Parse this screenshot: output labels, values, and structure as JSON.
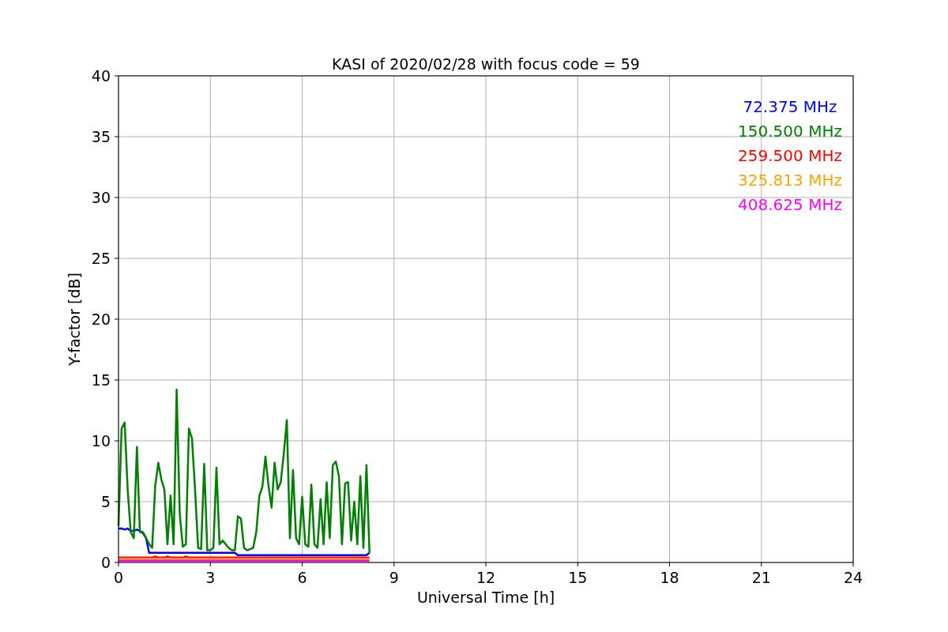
{
  "chart_data": {
    "type": "line",
    "title": "KASI of 2020/02/28 with focus code = 59",
    "xlabel": "Universal Time [h]",
    "ylabel": "Y-factor [dB]",
    "x": [
      0,
      0.1,
      0.2,
      0.3,
      0.4,
      0.5,
      0.6,
      0.7,
      0.8,
      0.9,
      1,
      1.1,
      1.2,
      1.3,
      1.4,
      1.5,
      1.6,
      1.7,
      1.8,
      1.9,
      2,
      2.1,
      2.2,
      2.3,
      2.4,
      2.5,
      2.6,
      2.7,
      2.8,
      2.9,
      3,
      3.1,
      3.2,
      3.3,
      3.4,
      3.5,
      3.6,
      3.7,
      3.8,
      3.9,
      4,
      4.1,
      4.2,
      4.3,
      4.4,
      4.5,
      4.6,
      4.7,
      4.8,
      4.9,
      5,
      5.1,
      5.2,
      5.3,
      5.4,
      5.5,
      5.6,
      5.7,
      5.8,
      5.9,
      6,
      6.1,
      6.2,
      6.3,
      6.4,
      6.5,
      6.6,
      6.7,
      6.8,
      6.9,
      7,
      7.1,
      7.2,
      7.3,
      7.4,
      7.5,
      7.6,
      7.7,
      7.8,
      7.9,
      8,
      8.1,
      8.2
    ],
    "series": [
      {
        "name": "72.375 MHz",
        "color": "#0000ff",
        "values": [
          2.8,
          2.8,
          2.7,
          2.8,
          2.6,
          2.6,
          2.7,
          2.6,
          2.4,
          2.0,
          0.8,
          0.8,
          0.8,
          0.8,
          0.8,
          0.8,
          0.8,
          0.8,
          0.8,
          0.8,
          0.8,
          0.8,
          0.8,
          0.8,
          0.8,
          0.8,
          0.8,
          0.8,
          0.8,
          0.8,
          0.8,
          0.8,
          0.8,
          0.8,
          0.8,
          0.8,
          0.8,
          0.8,
          0.8,
          0.6,
          0.6,
          0.6,
          0.6,
          0.6,
          0.6,
          0.6,
          0.6,
          0.6,
          0.6,
          0.6,
          0.6,
          0.6,
          0.6,
          0.6,
          0.6,
          0.6,
          0.6,
          0.6,
          0.6,
          0.6,
          0.6,
          0.6,
          0.6,
          0.6,
          0.6,
          0.6,
          0.6,
          0.6,
          0.6,
          0.6,
          0.6,
          0.6,
          0.6,
          0.6,
          0.6,
          0.6,
          0.6,
          0.6,
          0.6,
          0.6,
          0.6,
          0.6,
          0.8
        ]
      },
      {
        "name": "150.500 MHz",
        "color": "#008000",
        "values": [
          3,
          11,
          11.5,
          6,
          2.5,
          2,
          9.5,
          2.5,
          2.5,
          2,
          1.5,
          1.2,
          6.3,
          8.2,
          6.8,
          6,
          1.5,
          5.5,
          1.5,
          14.2,
          4,
          1.3,
          1.5,
          11,
          10.2,
          6,
          1.2,
          1.1,
          8.1,
          1,
          1,
          1.2,
          7.8,
          1.5,
          1.8,
          1.5,
          1.2,
          1,
          1,
          3.8,
          3.6,
          1.2,
          1,
          1.1,
          1.2,
          2.5,
          5.5,
          6.2,
          8.7,
          6.3,
          4.5,
          8.2,
          6,
          6.6,
          9,
          11.7,
          2,
          7.6,
          2,
          1.5,
          5.4,
          1.5,
          1.3,
          6.4,
          1.5,
          1.2,
          5.2,
          1.5,
          6.6,
          2,
          8,
          8.3,
          7.1,
          1.5,
          6.5,
          6.6,
          1.8,
          5,
          1.5,
          7.1,
          1.2,
          8,
          0.8
        ]
      },
      {
        "name": "259.500 MHz",
        "color": "#ff0000",
        "values": [
          0.4,
          0.4,
          0.4,
          0.4,
          0.4,
          0.4,
          0.4,
          0.4,
          0.4,
          0.4,
          0.4,
          0.4,
          0.5,
          0.4,
          0.4,
          0.4,
          0.5,
          0.4,
          0.4,
          0.4,
          0.4,
          0.4,
          0.5,
          0.4,
          0.4,
          0.4,
          0.4,
          0.4,
          0.4,
          0.4,
          0.4,
          0.4,
          0.4,
          0.4,
          0.4,
          0.4,
          0.4,
          0.4,
          0.4,
          0.4,
          0.4,
          0.4,
          0.4,
          0.4,
          0.4,
          0.4,
          0.4,
          0.4,
          0.4,
          0.4,
          0.4,
          0.4,
          0.4,
          0.4,
          0.4,
          0.4,
          0.4,
          0.4,
          0.4,
          0.4,
          0.4,
          0.4,
          0.4,
          0.4,
          0.4,
          0.4,
          0.4,
          0.4,
          0.4,
          0.4,
          0.4,
          0.4,
          0.4,
          0.4,
          0.4,
          0.4,
          0.4,
          0.4,
          0.4,
          0.4,
          0.4,
          0.4,
          0.4
        ]
      },
      {
        "name": "325.813 MHz",
        "color": "#ffa500",
        "values": [
          0.3,
          0.3,
          0.3,
          0.3,
          0.3,
          0.3,
          0.3,
          0.3,
          0.3,
          0.3,
          0.3,
          0.3,
          0.3,
          0.3,
          0.3,
          0.3,
          0.3,
          0.3,
          0.3,
          0.3,
          0.3,
          0.3,
          0.3,
          0.3,
          0.3,
          0.3,
          0.3,
          0.3,
          0.3,
          0.3,
          0.3,
          0.3,
          0.3,
          0.3,
          0.3,
          0.3,
          0.3,
          0.3,
          0.3,
          0.3,
          0.3,
          0.3,
          0.3,
          0.3,
          0.3,
          0.3,
          0.3,
          0.3,
          0.3,
          0.3,
          0.3,
          0.3,
          0.3,
          0.3,
          0.3,
          0.3,
          0.3,
          0.3,
          0.3,
          0.3,
          0.3,
          0.3,
          0.3,
          0.3,
          0.3,
          0.3,
          0.3,
          0.3,
          0.3,
          0.3,
          0.3,
          0.3,
          0.3,
          0.3,
          0.3,
          0.3,
          0.3,
          0.3,
          0.3,
          0.3,
          0.3,
          0.3,
          0.3
        ]
      },
      {
        "name": "408.625 MHz",
        "color": "#ff00ff",
        "values": [
          0.15,
          0.15,
          0.15,
          0.15,
          0.15,
          0.15,
          0.15,
          0.15,
          0.15,
          0.15,
          0.15,
          0.15,
          0.15,
          0.15,
          0.15,
          0.15,
          0.15,
          0.15,
          0.15,
          0.15,
          0.15,
          0.15,
          0.15,
          0.15,
          0.15,
          0.15,
          0.15,
          0.15,
          0.15,
          0.15,
          0.15,
          0.15,
          0.15,
          0.15,
          0.15,
          0.15,
          0.15,
          0.15,
          0.15,
          0.15,
          0.15,
          0.15,
          0.15,
          0.15,
          0.15,
          0.15,
          0.15,
          0.15,
          0.15,
          0.15,
          0.15,
          0.15,
          0.15,
          0.15,
          0.15,
          0.15,
          0.15,
          0.15,
          0.15,
          0.15,
          0.15,
          0.15,
          0.15,
          0.15,
          0.15,
          0.15,
          0.15,
          0.15,
          0.15,
          0.15,
          0.15,
          0.15,
          0.15,
          0.15,
          0.15,
          0.15,
          0.15,
          0.15,
          0.15,
          0.15,
          0.15,
          0.15,
          0.15
        ]
      }
    ],
    "grid": true,
    "xlim": [
      0,
      24
    ],
    "ylim": [
      0,
      40
    ],
    "xticks": [
      0,
      3,
      6,
      9,
      12,
      15,
      18,
      21,
      24
    ],
    "yticks": [
      0,
      5,
      10,
      15,
      20,
      25,
      30,
      35,
      40
    ]
  }
}
